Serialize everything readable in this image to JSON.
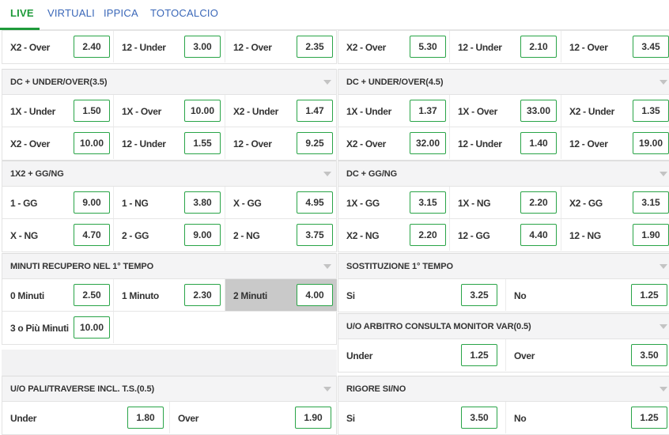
{
  "tabs": [
    "LIVE",
    "VIRTUALI",
    "IPPICA",
    "TOTOCALCIO"
  ],
  "left": [
    {
      "title": null,
      "rows": [
        [
          [
            "X2 - Over",
            "2.40"
          ],
          [
            "12 - Under",
            "3.00"
          ],
          [
            "12 - Over",
            "2.35"
          ]
        ]
      ]
    },
    {
      "title": "DC + UNDER/OVER(3.5)",
      "rows": [
        [
          [
            "1X - Under",
            "1.50"
          ],
          [
            "1X - Over",
            "10.00"
          ],
          [
            "X2 - Under",
            "1.47"
          ]
        ],
        [
          [
            "X2 - Over",
            "10.00"
          ],
          [
            "12 - Under",
            "1.55"
          ],
          [
            "12 - Over",
            "9.25"
          ]
        ]
      ]
    },
    {
      "title": "1X2 + GG/NG",
      "rows": [
        [
          [
            "1 - GG",
            "9.00"
          ],
          [
            "1 - NG",
            "3.80"
          ],
          [
            "X - GG",
            "4.95"
          ]
        ],
        [
          [
            "X - NG",
            "4.70"
          ],
          [
            "2 - GG",
            "9.00"
          ],
          [
            "2 - NG",
            "3.75"
          ]
        ]
      ]
    },
    {
      "title": "MINUTI RECUPERO NEL 1° TEMPO",
      "rows": [
        [
          [
            "0 Minuti",
            "2.50"
          ],
          [
            "1 Minuto",
            "2.30"
          ],
          [
            "2 Minuti",
            "4.00"
          ]
        ],
        [
          [
            "3 o Più Minuti",
            "10.00"
          ]
        ]
      ]
    },
    {
      "title": "U/O PALI/TRAVERSE INCL. T.S.(0.5)",
      "rows": [
        [
          [
            "Under",
            "1.80"
          ],
          [
            "Over",
            "1.90"
          ]
        ]
      ]
    }
  ],
  "right": [
    {
      "title": null,
      "rows": [
        [
          [
            "X2 - Over",
            "5.30"
          ],
          [
            "12 - Under",
            "2.10"
          ],
          [
            "12 - Over",
            "3.45"
          ]
        ]
      ]
    },
    {
      "title": "DC + UNDER/OVER(4.5)",
      "rows": [
        [
          [
            "1X - Under",
            "1.37"
          ],
          [
            "1X - Over",
            "33.00"
          ],
          [
            "X2 - Under",
            "1.35"
          ]
        ],
        [
          [
            "X2 - Over",
            "32.00"
          ],
          [
            "12 - Under",
            "1.40"
          ],
          [
            "12 - Over",
            "19.00"
          ]
        ]
      ]
    },
    {
      "title": "DC + GG/NG",
      "rows": [
        [
          [
            "1X - GG",
            "3.15"
          ],
          [
            "1X - NG",
            "2.20"
          ],
          [
            "X2 - GG",
            "3.15"
          ]
        ],
        [
          [
            "X2 - NG",
            "2.20"
          ],
          [
            "12 - GG",
            "4.40"
          ],
          [
            "12 - NG",
            "1.90"
          ]
        ]
      ]
    },
    {
      "title": "SOSTITUZIONE 1° TEMPO",
      "rows": [
        [
          [
            "Si",
            "3.25"
          ],
          [
            "No",
            "1.25"
          ]
        ]
      ]
    },
    {
      "title": "U/O ARBITRO CONSULTA MONITOR VAR(0.5)",
      "rows": [
        [
          [
            "Under",
            "1.25"
          ],
          [
            "Over",
            "3.50"
          ]
        ]
      ]
    },
    {
      "title": "RIGORE SI/NO",
      "rows": [
        [
          [
            "Si",
            "3.50"
          ],
          [
            "No",
            "1.25"
          ]
        ]
      ]
    }
  ]
}
